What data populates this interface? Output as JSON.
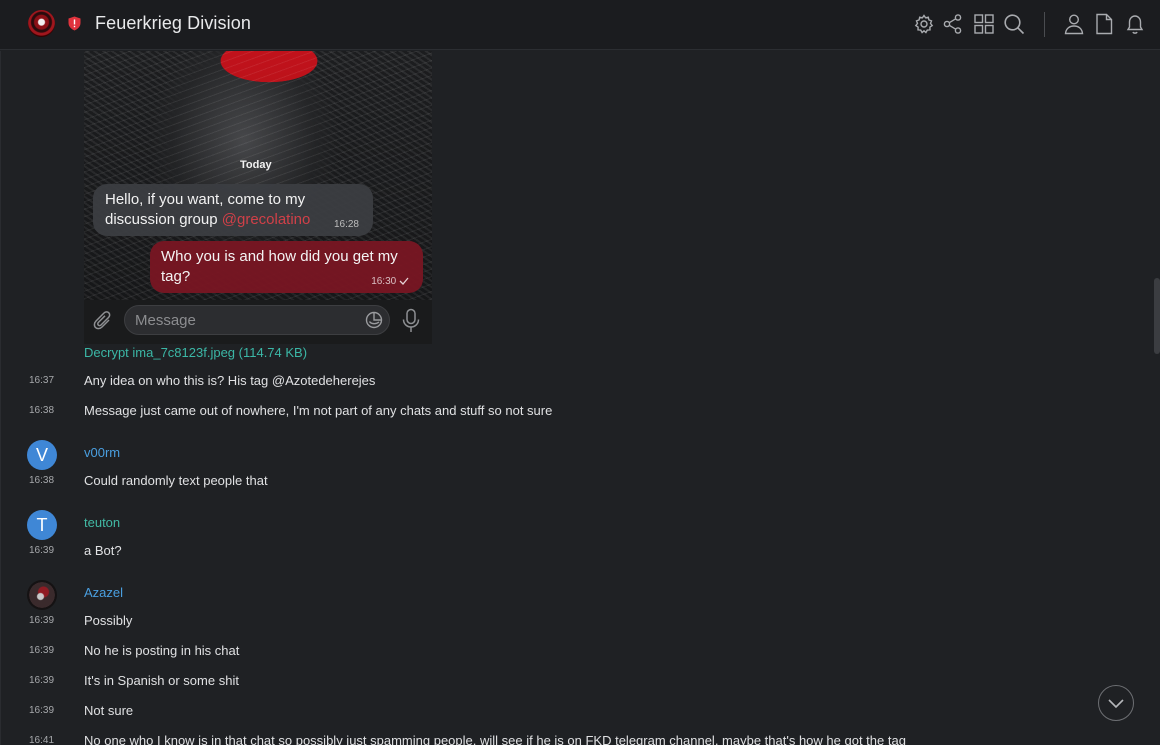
{
  "header": {
    "title": "Feuerkrieg Division",
    "icons": [
      "settings-icon",
      "share-icon",
      "grid-icon",
      "search-icon",
      "user-icon",
      "file-icon",
      "bell-icon"
    ]
  },
  "image_message": {
    "today_label": "Today",
    "incoming": {
      "line1": "Hello, if you want, come to my",
      "line2": "discussion group",
      "mention": "@grecolatino",
      "time": "16:28"
    },
    "outgoing": {
      "line1": "Who you is and how did you get my",
      "line2": "tag?",
      "time": "16:30"
    },
    "composer_placeholder": "Message",
    "decrypt_link": "Decrypt ima_7c8123f.jpeg (114.74 KB)"
  },
  "messages": [
    {
      "time": "16:37",
      "text": "Any idea on who this is? His tag @Azotedeherejes"
    },
    {
      "time": "16:38",
      "text": "Message just came out of nowhere, I'm not part of any chats and stuff so not sure"
    },
    {
      "sender": "v00rm",
      "avatar_letter": "V",
      "sender_color": "#4a9fe0",
      "time": "16:38",
      "text": "Could randomly text people that"
    },
    {
      "sender": "teuton",
      "avatar_letter": "T",
      "sender_color": "#42b9a4",
      "time": "16:39",
      "text": "a Bot?"
    },
    {
      "sender": "Azazel",
      "sender_color": "#4a9fe0",
      "time": "16:39",
      "text": "Possibly"
    },
    {
      "time": "16:39",
      "text": "No he is posting in his chat"
    },
    {
      "time": "16:39",
      "text": "It's in Spanish or some shit"
    },
    {
      "time": "16:39",
      "text": "Not sure"
    },
    {
      "time": "16:41",
      "text": "No one who I know is in that chat so possibly just spamming people, will see if he is on FKD telegram channel, maybe that's how he got the tag"
    }
  ],
  "colors": {
    "accent": "#3f87d6",
    "decrypt_link": "#3bb7a6",
    "outgoing_bubble": "#781622"
  }
}
